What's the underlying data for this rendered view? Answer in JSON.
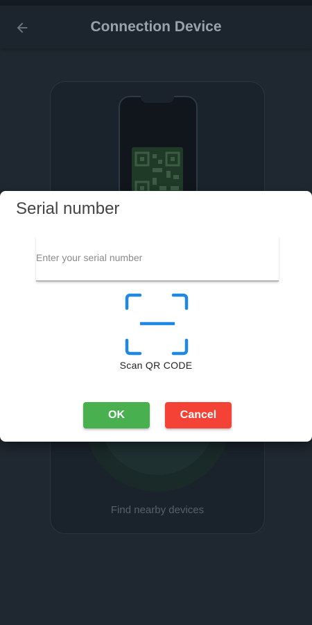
{
  "appbar": {
    "title": "Connection Device",
    "back_icon": "arrow-left-icon"
  },
  "background_card": {
    "find_label": "Find nearby devices"
  },
  "dialog": {
    "title": "Serial number",
    "serial_input": {
      "value": "",
      "placeholder": "Enter your serial number"
    },
    "scan_icon": "qr-scan-icon",
    "scan_label": "Scan QR CODE",
    "ok_label": "OK",
    "cancel_label": "Cancel"
  },
  "colors": {
    "ok": "#49b050",
    "cancel": "#f44336",
    "scan_accent": "#1e88e5",
    "background": "#1f2830"
  }
}
